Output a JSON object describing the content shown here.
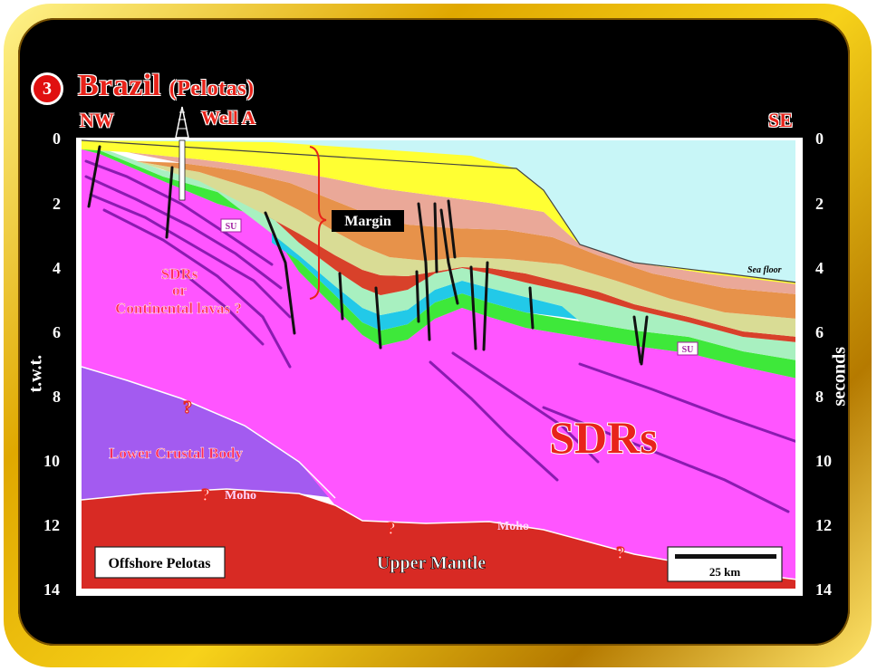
{
  "title": {
    "number": "3",
    "main": "Brazil",
    "sub": "(Pelotas)"
  },
  "directions": {
    "left": "NW",
    "right": "SE"
  },
  "well_label": "Well A",
  "axis": {
    "left_title": "t.w.t.",
    "right_title": "seconds",
    "ticks": [
      "0",
      "2",
      "4",
      "6",
      "8",
      "10",
      "12",
      "14"
    ]
  },
  "labels": {
    "margin": "Margin",
    "sea_floor": "Sea floor",
    "su_1": "SU",
    "su_2": "SU",
    "sdrs_or_lavas_1": "SDRs",
    "sdrs_or_lavas_2": "or",
    "sdrs_or_lavas_3": "Continental lavas ?",
    "sdrs_big": "SDRs",
    "lower_crustal_body": "Lower Crustal Body",
    "moho_1": "Moho",
    "moho_2": "Moho",
    "upper_mantle": "Upper Mantle",
    "question": "?",
    "location_box": "Offshore Pelotas",
    "scale_bar": "25 km"
  },
  "colors": {
    "sea": "#c8f6f7",
    "yellow_layer": "#ffff33",
    "salmon_layer": "#eaa898",
    "orange_layer": "#e7924a",
    "khaki_layer": "#d9dc95",
    "red_layer": "#d8412a",
    "mint_layer": "#a8f0c0",
    "blue_layer": "#22c9e8",
    "green_layer": "#3ee83a",
    "sdr_magenta": "#ff55ff",
    "lower_crust": "#a35bf0",
    "mantle": "#d82a24",
    "reflector": "#8a1bb0",
    "fault": "#111111",
    "label_red": "#e8231a"
  }
}
